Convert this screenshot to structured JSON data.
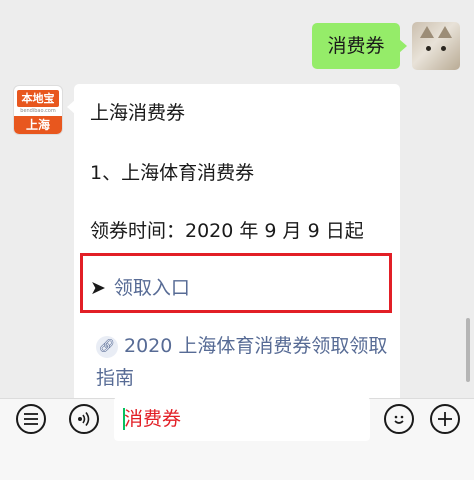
{
  "messages": {
    "sent": {
      "text": "消费券"
    },
    "received": {
      "sender_logo": {
        "brand": "本地宝",
        "subtitle": "bendibao.com",
        "city": "上海"
      },
      "lines": [
        "上海消费券",
        "1、上海体育消费券",
        "领券时间：2020 年 9 月 9 日起"
      ],
      "entry_link": {
        "arrow": "➤",
        "label": "领取入口"
      },
      "guide_link": {
        "icon": "link-icon",
        "label": "2020 上海体育消费券领取领取指南"
      }
    }
  },
  "toolbar": {
    "menu_icon": "menu-icon",
    "voice_icon": "voice-icon",
    "input_value": "消费券",
    "emoji_icon": "emoji-icon",
    "add_icon": "add-icon"
  },
  "colors": {
    "sent_bubble": "#95ec69",
    "link": "#576b95",
    "highlight": "#e21f26",
    "logo": "#e8571e"
  }
}
